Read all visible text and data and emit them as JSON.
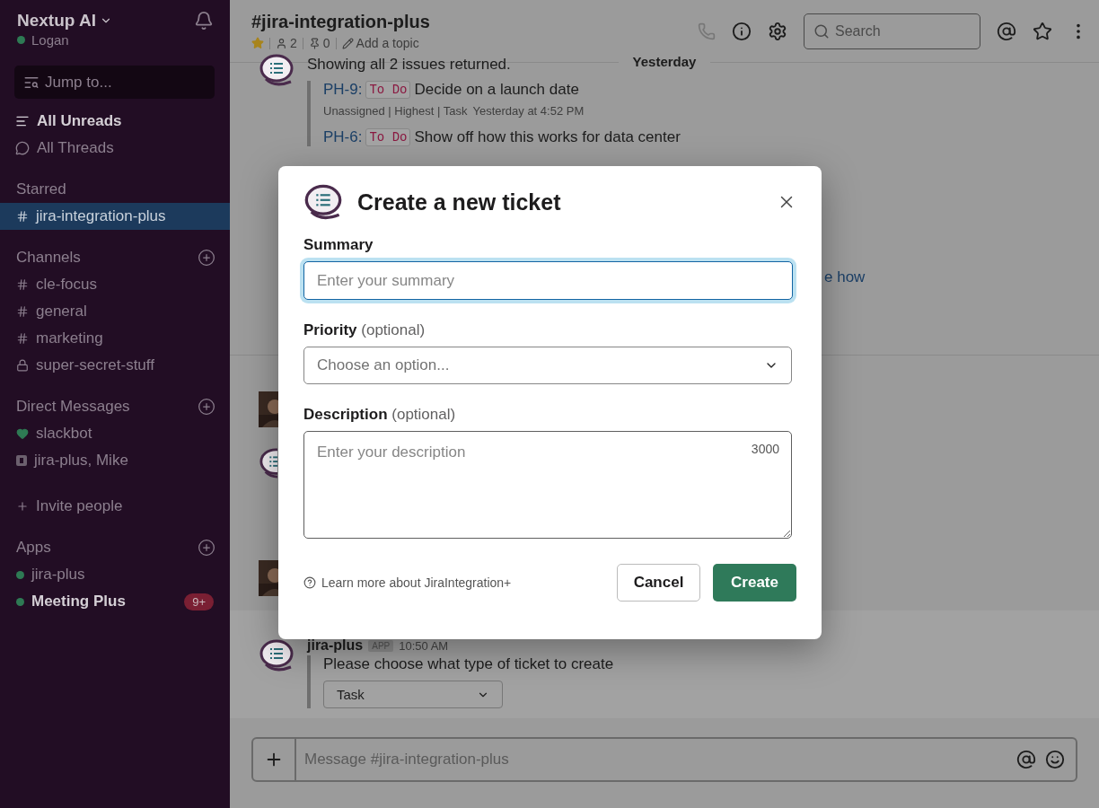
{
  "workspace": {
    "name": "Nextup AI",
    "user": "Logan",
    "online": true
  },
  "jump_to": {
    "placeholder": "Jump to..."
  },
  "nav": [
    {
      "label": "All Unreads",
      "kind": "unreads",
      "unread": true
    },
    {
      "label": "All Threads",
      "kind": "threads",
      "unread": false
    }
  ],
  "sections": [
    {
      "title": "Starred",
      "addable": false,
      "items": [
        {
          "label": "jira-integration-plus",
          "kind": "channel",
          "selected": true,
          "unread": false
        }
      ]
    },
    {
      "title": "Channels",
      "addable": true,
      "items": [
        {
          "label": "cle-focus",
          "kind": "channel",
          "selected": false,
          "unread": false
        },
        {
          "label": "general",
          "kind": "channel",
          "selected": false,
          "unread": false
        },
        {
          "label": "marketing",
          "kind": "channel",
          "selected": false,
          "unread": false
        },
        {
          "label": "super-secret-stuff",
          "kind": "private",
          "selected": false,
          "unread": false
        }
      ]
    },
    {
      "title": "Direct Messages",
      "addable": true,
      "items": [
        {
          "label": "slackbot",
          "kind": "bot",
          "selected": false,
          "unread": false
        },
        {
          "label": "jira-plus, Mike",
          "kind": "group",
          "selected": false,
          "unread": false
        },
        {
          "label": "Invite people",
          "kind": "invite",
          "selected": false,
          "unread": false
        }
      ]
    },
    {
      "title": "Apps",
      "addable": true,
      "items": [
        {
          "label": "jira-plus",
          "kind": "app",
          "selected": false,
          "unread": false
        },
        {
          "label": "Meeting Plus",
          "kind": "app",
          "selected": false,
          "unread": true,
          "badge": "9+"
        }
      ]
    }
  ],
  "header": {
    "title": "#jira-integration-plus",
    "starred": true,
    "members": "2",
    "pins": "0",
    "topic": "Add a topic",
    "search": {
      "placeholder": "Search"
    }
  },
  "divider": "Yesterday",
  "issue_message": {
    "text": "Showing all 2 issues returned.",
    "issues": [
      {
        "key": "PH-9:",
        "status": "To Do",
        "title": "Decide on a launch date",
        "meta": "Unassigned | Highest | Task",
        "time": "Yesterday at 4:52 PM"
      },
      {
        "key": "PH-6:",
        "status": "To Do",
        "title": "Show off how this works for data center"
      }
    ]
  },
  "link_fragment": "e how",
  "last_message": {
    "sender": "jira-plus",
    "tag": "APP",
    "time": "10:50 AM",
    "text": "Please choose what type of ticket to create",
    "select": "Task"
  },
  "composer": {
    "placeholder": "Message #jira-integration-plus"
  },
  "modal": {
    "title": "Create a new ticket",
    "fields": [
      {
        "kind": "text",
        "label": "Summary",
        "placeholder": "Enter your summary",
        "focused": true
      },
      {
        "kind": "select",
        "label": "Priority",
        "hint": "(optional)",
        "placeholder": "Choose an option...",
        "focused": false
      },
      {
        "kind": "textarea",
        "label": "Description",
        "hint": "(optional)",
        "placeholder": "Enter your description",
        "counter": "3000",
        "focused": false
      }
    ],
    "help_link": "Learn more about JiraIntegration+",
    "buttons": [
      {
        "label": "Cancel",
        "kind": "secondary"
      },
      {
        "label": "Create",
        "kind": "primary"
      }
    ]
  }
}
